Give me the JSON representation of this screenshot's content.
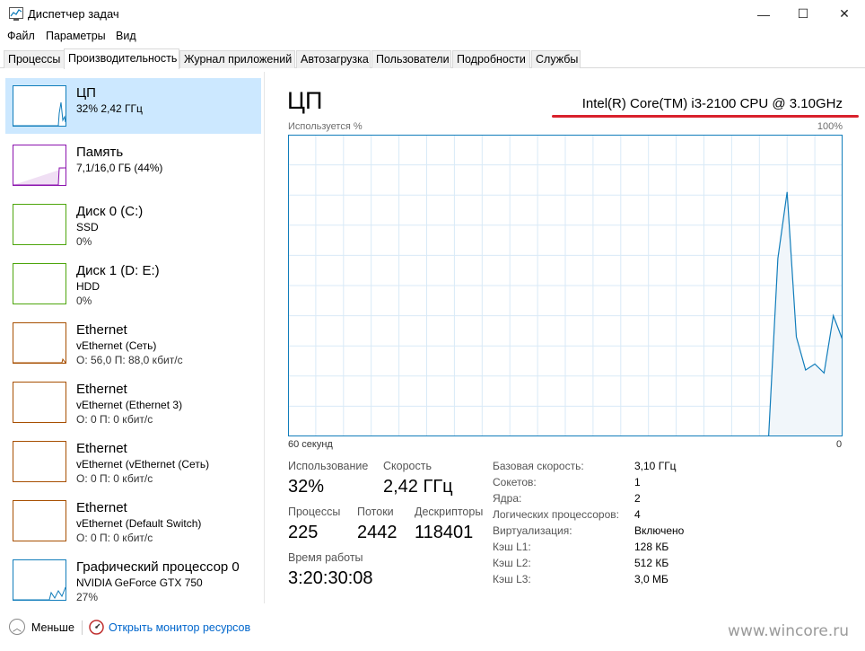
{
  "window": {
    "title": "Диспетчер задач",
    "min_glyph": "—",
    "max_glyph": "☐",
    "close_glyph": "✕"
  },
  "menu": [
    "Файл",
    "Параметры",
    "Вид"
  ],
  "tabs": [
    "Процессы",
    "Производительность",
    "Журнал приложений",
    "Автозагрузка",
    "Пользователи",
    "Подробности",
    "Службы"
  ],
  "active_tab": "Производительность",
  "sidebar": {
    "items": [
      {
        "title": "ЦП",
        "line1": "32% 2,42 ГГц",
        "line2": "",
        "color": "#117dbb"
      },
      {
        "title": "Память",
        "line1": "7,1/16,0 ГБ (44%)",
        "line2": "",
        "color": "#8b12ae"
      },
      {
        "title": "Диск 0 (C:)",
        "line1": "SSD",
        "line2": "0%",
        "color": "#4da60c"
      },
      {
        "title": "Диск 1 (D: E:)",
        "line1": "HDD",
        "line2": "0%",
        "color": "#4da60c"
      },
      {
        "title": "Ethernet",
        "line1": "vEthernet (Сеть)",
        "line2": "О: 56,0 П: 88,0 кбит/с",
        "color": "#a74f01"
      },
      {
        "title": "Ethernet",
        "line1": "vEthernet (Ethernet 3)",
        "line2": "О: 0 П: 0 кбит/с",
        "color": "#a74f01"
      },
      {
        "title": "Ethernet",
        "line1": "vEthernet (vEthernet (Сеть)",
        "line2": "О: 0 П: 0 кбит/с",
        "color": "#a74f01"
      },
      {
        "title": "Ethernet",
        "line1": "vEthernet (Default Switch)",
        "line2": "О: 0 П: 0 кбит/с",
        "color": "#a74f01"
      },
      {
        "title": "Графический процессор 0",
        "line1": "NVIDIA GeForce GTX 750",
        "line2": "27%",
        "color": "#117dbb"
      }
    ]
  },
  "main": {
    "title": "ЦП",
    "model": "Intel(R) Core(TM) i3-2100 CPU @ 3.10GHz",
    "usage_label": "Используется %",
    "max_label": "100%",
    "time_left": "60 секунд",
    "time_right": "0",
    "graph_color": "#117dbb",
    "stats": {
      "utilization_label": "Использование",
      "utilization": "32%",
      "speed_label": "Скорость",
      "speed": "2,42 ГГц",
      "processes_label": "Процессы",
      "processes": "225",
      "threads_label": "Потоки",
      "threads": "2442",
      "handles_label": "Дескрипторы",
      "handles": "118401",
      "uptime_label": "Время работы",
      "uptime": "3:20:30:08"
    },
    "details": [
      {
        "label": "Базовая скорость:",
        "value": "3,10 ГГц"
      },
      {
        "label": "Сокетов:",
        "value": "1"
      },
      {
        "label": "Ядра:",
        "value": "2"
      },
      {
        "label": "Логических процессоров:",
        "value": "4"
      },
      {
        "label": "Виртуализация:",
        "value": "Включено"
      },
      {
        "label": "Кэш L1:",
        "value": "128 КБ"
      },
      {
        "label": "Кэш L2:",
        "value": "512 КБ"
      },
      {
        "label": "Кэш L3:",
        "value": "3,0 МБ"
      }
    ]
  },
  "cpu_history_percent": [
    0,
    0,
    0,
    0,
    0,
    0,
    0,
    0,
    0,
    0,
    0,
    0,
    0,
    0,
    0,
    0,
    0,
    0,
    0,
    0,
    0,
    0,
    0,
    0,
    0,
    0,
    0,
    0,
    0,
    0,
    0,
    0,
    0,
    0,
    0,
    0,
    0,
    0,
    0,
    0,
    0,
    0,
    0,
    0,
    0,
    0,
    0,
    0,
    0,
    0,
    0,
    0,
    0,
    59,
    81,
    33,
    22,
    24,
    21,
    40,
    32
  ],
  "footer": {
    "less_label": "Меньше",
    "monitor_link": "Открыть монитор ресурсов",
    "watermark": "www.wincore.ru"
  }
}
